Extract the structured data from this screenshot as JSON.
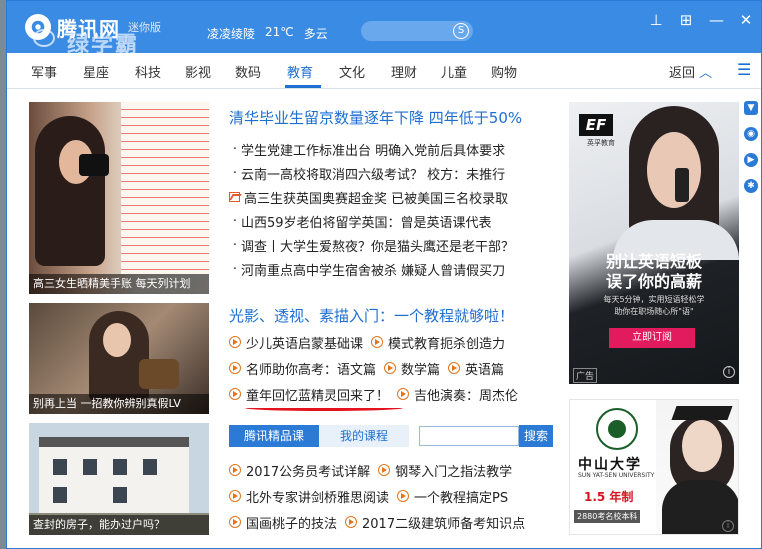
{
  "window": {
    "logo_text": "腾讯网",
    "logo_sub": "迷你版",
    "watermark": "绿学霸",
    "weather_city": "凌凌绫陵",
    "weather_temp": "21℃",
    "weather_desc": "多云",
    "controls": [
      "pin",
      "maximize",
      "minimize",
      "close"
    ]
  },
  "nav": {
    "items": [
      "军事",
      "星座",
      "科技",
      "影视",
      "数码",
      "教育",
      "文化",
      "理财",
      "儿童",
      "购物"
    ],
    "active": "教育",
    "back_label": "返回"
  },
  "thumbnails": [
    {
      "caption": "高三女生晒精美手账  每天列计划"
    },
    {
      "caption": "别再上当 一招教你辨别真假LV"
    },
    {
      "caption": "查封的房子，能办过户吗？"
    }
  ],
  "headline": "清华毕业生留京数量逐年下降 四年低于50%",
  "news": [
    "学生党建工作标准出台 明确入党前后具体要求",
    "云南一高校将取消四六级考试？ 校方：未推行",
    "高三生获英国奥赛超金奖 已被美国三名校录取",
    "山西59岁老伯将留学英国：曾是英语课代表",
    "调查丨大学生爱熬夜？你是猫头鹰还是老干部？",
    "河南重点高中学生宿舍被杀 嫌疑人曾请假买刀"
  ],
  "headline2": "光影、透视、素描入门：一个教程就够啦！",
  "play_rows": [
    [
      "少儿英语启蒙基础课",
      "模式教育扼杀创造力"
    ],
    [
      "名师助你高考：语文篇",
      "数学篇",
      "英语篇"
    ],
    [
      "童年回忆蓝精灵回来了！",
      "吉他演奏：周杰伦"
    ]
  ],
  "course_tabs": {
    "tab1": "腾讯精品课",
    "tab2": "我的课程",
    "search_btn": "搜索"
  },
  "courses": [
    [
      "2017公务员考试详解",
      "钢琴入门之指法教学"
    ],
    [
      "北外专家讲剑桥雅思阅读",
      "一个教程搞定PS"
    ],
    [
      "国画桃子的技法",
      "2017二级建筑师备考知识点"
    ]
  ],
  "ad1": {
    "brand": "EF",
    "brand_sub": "英孚教育",
    "line1": "别让英语短板",
    "line2": "误了你的高薪",
    "desc1": "每天5分钟，实用短语轻松学",
    "desc2": "助你在职场随心所\"语\"",
    "cta": "立即订阅",
    "tag": "广告"
  },
  "ad2": {
    "uni": "中山大学",
    "uni_en": "SUN YAT-SEN UNIVERSITY",
    "years": "1.5 年制",
    "bottom": "2880考名校本科"
  },
  "colors": {
    "titlebar": "#3a8be3",
    "accent": "#1e6fd0",
    "play_icon": "#e0761e",
    "underline": "#e4121c"
  }
}
